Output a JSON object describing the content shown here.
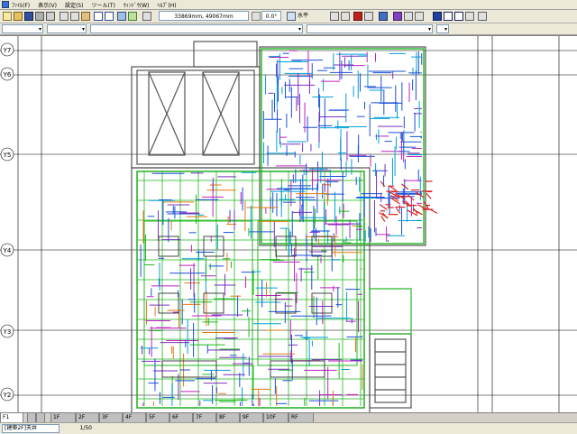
{
  "menus": [
    "ﾌｧｲﾙ(F)",
    "表示(V)",
    "設定(S)",
    "ツール(T)",
    "ｳｨﾝﾄﾞｳ(W)",
    "ﾍﾙﾌﾟ(H)"
  ],
  "toolbar": {
    "coordinates": "33869mm,  49067mm",
    "angle": "0.0°",
    "plane_label": "水平",
    "brand_colors": {
      "menu_bg": "#ece9d8",
      "canvas": "#ffffff",
      "grid": "#000000"
    }
  },
  "grid_axes": {
    "y_labels": [
      "Y7",
      "Y6",
      "Y5",
      "Y4",
      "Y3",
      "Y2"
    ]
  },
  "drawing": {
    "pipe_colors": {
      "green": "#1fb81f",
      "blue": "#1a4fd8",
      "cyan": "#00a0d8",
      "magenta": "#c020c0",
      "red": "#e02020",
      "orange": "#e07a10",
      "purple": "#7a30c0"
    }
  },
  "status": {
    "layer": "[建築2F]天井",
    "scale": "1/50",
    "floor_selector": "F1"
  },
  "tabs": [
    "1F",
    "2F",
    "3F",
    "4F",
    "5F",
    "6F",
    "7F",
    "8F",
    "9F",
    "10F",
    "RF"
  ]
}
